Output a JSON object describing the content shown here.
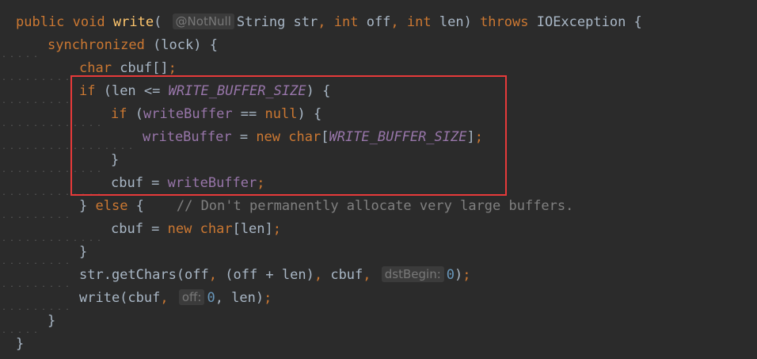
{
  "editor": {
    "lines": [
      {
        "segments": [
          {
            "t": "public",
            "c": "kw"
          },
          {
            "t": " "
          },
          {
            "t": "void",
            "c": "kw"
          },
          {
            "t": " "
          },
          {
            "t": "write",
            "c": "fn"
          },
          {
            "t": "( "
          },
          {
            "t": "@NotNull",
            "c": "hint"
          },
          {
            "t": "String str"
          },
          {
            "t": ",",
            "c": "punct"
          },
          {
            "t": " "
          },
          {
            "t": "int",
            "c": "kw"
          },
          {
            "t": " off"
          },
          {
            "t": ",",
            "c": "punct"
          },
          {
            "t": " "
          },
          {
            "t": "int",
            "c": "kw"
          },
          {
            "t": " len) "
          },
          {
            "t": "throws",
            "c": "kw"
          },
          {
            "t": " IOException {"
          }
        ]
      },
      {
        "segments": [
          {
            "t": "synchronized",
            "c": "kw"
          },
          {
            "t": " (lock) {"
          }
        ]
      },
      {
        "segments": [
          {
            "t": "char",
            "c": "kw"
          },
          {
            "t": " cbuf[]"
          },
          {
            "t": ";",
            "c": "punct"
          }
        ]
      },
      {
        "segments": [
          {
            "t": "if",
            "c": "kw"
          },
          {
            "t": " (len <= "
          },
          {
            "t": "WRITE_BUFFER_SIZE",
            "c": "const"
          },
          {
            "t": ") {"
          }
        ]
      },
      {
        "segments": [
          {
            "t": "if",
            "c": "kw"
          },
          {
            "t": " ("
          },
          {
            "t": "writeBuffer",
            "c": "field"
          },
          {
            "t": " == "
          },
          {
            "t": "null",
            "c": "kw"
          },
          {
            "t": ") {"
          }
        ]
      },
      {
        "segments": [
          {
            "t": "writeBuffer",
            "c": "field"
          },
          {
            "t": " = "
          },
          {
            "t": "new",
            "c": "kw"
          },
          {
            "t": " "
          },
          {
            "t": "char",
            "c": "kw"
          },
          {
            "t": "["
          },
          {
            "t": "WRITE_BUFFER_SIZE",
            "c": "const"
          },
          {
            "t": "]"
          },
          {
            "t": ";",
            "c": "punct"
          }
        ]
      },
      {
        "segments": [
          {
            "t": "}"
          }
        ]
      },
      {
        "segments": [
          {
            "t": "cbuf = "
          },
          {
            "t": "writeBuffer",
            "c": "field"
          },
          {
            "t": ";",
            "c": "punct"
          }
        ]
      },
      {
        "segments": [
          {
            "t": "} "
          },
          {
            "t": "else",
            "c": "kw"
          },
          {
            "t": " {    "
          },
          {
            "t": "// Don't permanently allocate very large buffers.",
            "c": "cmt"
          }
        ]
      },
      {
        "segments": [
          {
            "t": "cbuf = "
          },
          {
            "t": "new",
            "c": "kw"
          },
          {
            "t": " "
          },
          {
            "t": "char",
            "c": "kw"
          },
          {
            "t": "[len]"
          },
          {
            "t": ";",
            "c": "punct"
          }
        ]
      },
      {
        "segments": [
          {
            "t": "}"
          }
        ]
      },
      {
        "segments": [
          {
            "t": "str.getChars(off"
          },
          {
            "t": ",",
            "c": "punct"
          },
          {
            "t": " (off + len)"
          },
          {
            "t": ",",
            "c": "punct"
          },
          {
            "t": " cbuf"
          },
          {
            "t": ",",
            "c": "punct"
          },
          {
            "t": " "
          },
          {
            "t": "dstBegin:",
            "c": "hint"
          },
          {
            "t": "0",
            "c": "num"
          },
          {
            "t": ")"
          },
          {
            "t": ";",
            "c": "punct"
          }
        ]
      },
      {
        "segments": [
          {
            "t": "write(cbuf"
          },
          {
            "t": ",",
            "c": "punct"
          },
          {
            "t": " "
          },
          {
            "t": "off:",
            "c": "hint"
          },
          {
            "t": "0",
            "c": "num"
          },
          {
            "t": ","
          },
          {
            "t": " len)"
          },
          {
            "t": ";",
            "c": "punct"
          }
        ]
      },
      {
        "segments": [
          {
            "t": "}"
          }
        ]
      },
      {
        "segments": [
          {
            "t": "}"
          }
        ]
      }
    ]
  },
  "colors": {
    "background": "#2b2b2b",
    "highlight_box": "#e63a3a"
  }
}
